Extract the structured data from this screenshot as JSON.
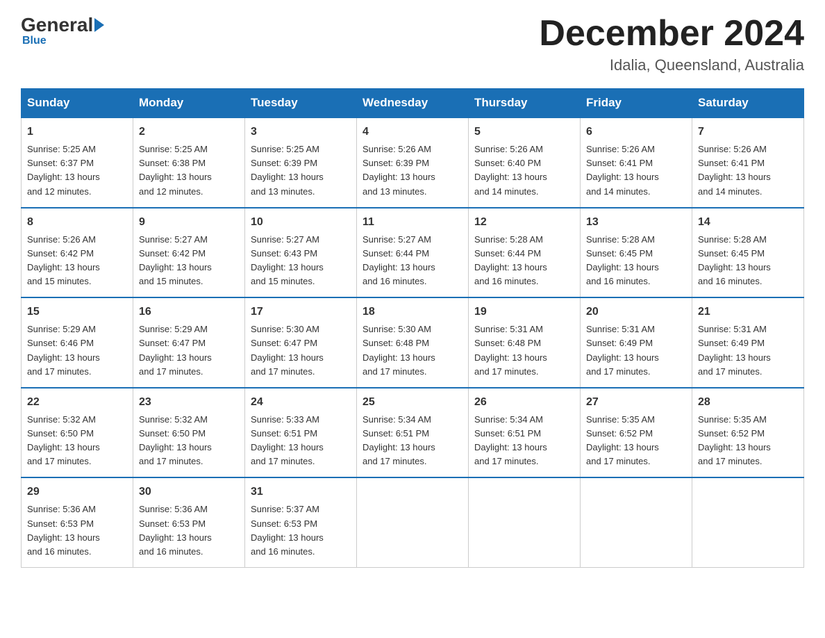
{
  "header": {
    "logo_general": "General",
    "logo_blue": "Blue",
    "month_title": "December 2024",
    "location": "Idalia, Queensland, Australia"
  },
  "weekdays": [
    "Sunday",
    "Monday",
    "Tuesday",
    "Wednesday",
    "Thursday",
    "Friday",
    "Saturday"
  ],
  "weeks": [
    [
      {
        "day": "1",
        "sunrise": "5:25 AM",
        "sunset": "6:37 PM",
        "daylight": "13 hours and 12 minutes."
      },
      {
        "day": "2",
        "sunrise": "5:25 AM",
        "sunset": "6:38 PM",
        "daylight": "13 hours and 12 minutes."
      },
      {
        "day": "3",
        "sunrise": "5:25 AM",
        "sunset": "6:39 PM",
        "daylight": "13 hours and 13 minutes."
      },
      {
        "day": "4",
        "sunrise": "5:26 AM",
        "sunset": "6:39 PM",
        "daylight": "13 hours and 13 minutes."
      },
      {
        "day": "5",
        "sunrise": "5:26 AM",
        "sunset": "6:40 PM",
        "daylight": "13 hours and 14 minutes."
      },
      {
        "day": "6",
        "sunrise": "5:26 AM",
        "sunset": "6:41 PM",
        "daylight": "13 hours and 14 minutes."
      },
      {
        "day": "7",
        "sunrise": "5:26 AM",
        "sunset": "6:41 PM",
        "daylight": "13 hours and 14 minutes."
      }
    ],
    [
      {
        "day": "8",
        "sunrise": "5:26 AM",
        "sunset": "6:42 PM",
        "daylight": "13 hours and 15 minutes."
      },
      {
        "day": "9",
        "sunrise": "5:27 AM",
        "sunset": "6:42 PM",
        "daylight": "13 hours and 15 minutes."
      },
      {
        "day": "10",
        "sunrise": "5:27 AM",
        "sunset": "6:43 PM",
        "daylight": "13 hours and 15 minutes."
      },
      {
        "day": "11",
        "sunrise": "5:27 AM",
        "sunset": "6:44 PM",
        "daylight": "13 hours and 16 minutes."
      },
      {
        "day": "12",
        "sunrise": "5:28 AM",
        "sunset": "6:44 PM",
        "daylight": "13 hours and 16 minutes."
      },
      {
        "day": "13",
        "sunrise": "5:28 AM",
        "sunset": "6:45 PM",
        "daylight": "13 hours and 16 minutes."
      },
      {
        "day": "14",
        "sunrise": "5:28 AM",
        "sunset": "6:45 PM",
        "daylight": "13 hours and 16 minutes."
      }
    ],
    [
      {
        "day": "15",
        "sunrise": "5:29 AM",
        "sunset": "6:46 PM",
        "daylight": "13 hours and 17 minutes."
      },
      {
        "day": "16",
        "sunrise": "5:29 AM",
        "sunset": "6:47 PM",
        "daylight": "13 hours and 17 minutes."
      },
      {
        "day": "17",
        "sunrise": "5:30 AM",
        "sunset": "6:47 PM",
        "daylight": "13 hours and 17 minutes."
      },
      {
        "day": "18",
        "sunrise": "5:30 AM",
        "sunset": "6:48 PM",
        "daylight": "13 hours and 17 minutes."
      },
      {
        "day": "19",
        "sunrise": "5:31 AM",
        "sunset": "6:48 PM",
        "daylight": "13 hours and 17 minutes."
      },
      {
        "day": "20",
        "sunrise": "5:31 AM",
        "sunset": "6:49 PM",
        "daylight": "13 hours and 17 minutes."
      },
      {
        "day": "21",
        "sunrise": "5:31 AM",
        "sunset": "6:49 PM",
        "daylight": "13 hours and 17 minutes."
      }
    ],
    [
      {
        "day": "22",
        "sunrise": "5:32 AM",
        "sunset": "6:50 PM",
        "daylight": "13 hours and 17 minutes."
      },
      {
        "day": "23",
        "sunrise": "5:32 AM",
        "sunset": "6:50 PM",
        "daylight": "13 hours and 17 minutes."
      },
      {
        "day": "24",
        "sunrise": "5:33 AM",
        "sunset": "6:51 PM",
        "daylight": "13 hours and 17 minutes."
      },
      {
        "day": "25",
        "sunrise": "5:34 AM",
        "sunset": "6:51 PM",
        "daylight": "13 hours and 17 minutes."
      },
      {
        "day": "26",
        "sunrise": "5:34 AM",
        "sunset": "6:51 PM",
        "daylight": "13 hours and 17 minutes."
      },
      {
        "day": "27",
        "sunrise": "5:35 AM",
        "sunset": "6:52 PM",
        "daylight": "13 hours and 17 minutes."
      },
      {
        "day": "28",
        "sunrise": "5:35 AM",
        "sunset": "6:52 PM",
        "daylight": "13 hours and 17 minutes."
      }
    ],
    [
      {
        "day": "29",
        "sunrise": "5:36 AM",
        "sunset": "6:53 PM",
        "daylight": "13 hours and 16 minutes."
      },
      {
        "day": "30",
        "sunrise": "5:36 AM",
        "sunset": "6:53 PM",
        "daylight": "13 hours and 16 minutes."
      },
      {
        "day": "31",
        "sunrise": "5:37 AM",
        "sunset": "6:53 PM",
        "daylight": "13 hours and 16 minutes."
      },
      null,
      null,
      null,
      null
    ]
  ],
  "labels": {
    "sunrise": "Sunrise:",
    "sunset": "Sunset:",
    "daylight": "Daylight:"
  }
}
